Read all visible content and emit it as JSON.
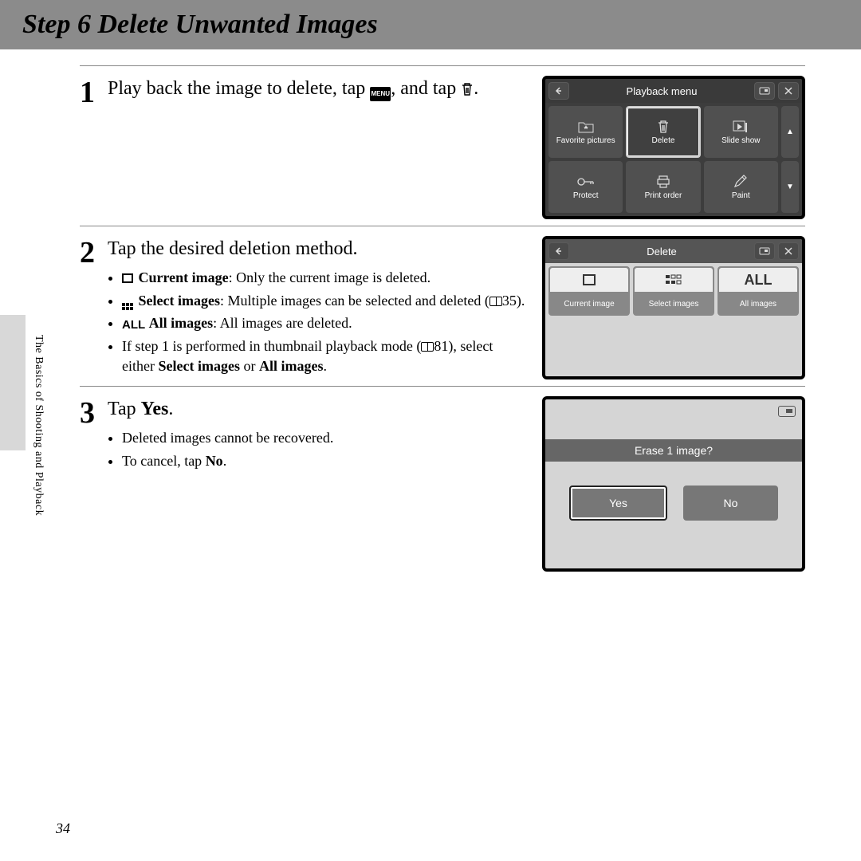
{
  "header": {
    "title": "Step 6 Delete Unwanted Images"
  },
  "sidebar_label": "The Basics of Shooting and Playback",
  "page_number": "34",
  "steps": [
    {
      "num": "1",
      "text_a": "Play back the image to delete, tap ",
      "text_b": ", and tap ",
      "text_c": ".",
      "bullets": []
    },
    {
      "num": "2",
      "text_a": "Tap the desired deletion method.",
      "bullets": [
        {
          "bold": "Current image",
          "rest": ": Only the current image is deleted."
        },
        {
          "bold": "Select images",
          "rest": ": Multiple images can be selected and deleted (",
          "ref": "35",
          "tail": ")."
        },
        {
          "bold": "All images",
          "rest": ": All images are deleted."
        },
        {
          "plain_a": "If step 1 is performed in thumbnail playback mode (",
          "ref": "81",
          "plain_b": "), select either ",
          "bold1": "Select images",
          "mid": " or ",
          "bold2": "All images",
          "end": "."
        }
      ]
    },
    {
      "num": "3",
      "text_a": "Tap ",
      "bold": "Yes",
      "text_b": ".",
      "bullets": [
        {
          "plain": "Deleted images cannot be recovered."
        },
        {
          "plain_a": "To cancel, tap ",
          "bold": "No",
          "end": "."
        }
      ]
    }
  ],
  "screen1": {
    "title": "Playback menu",
    "cells": [
      {
        "label": "Favorite pictures"
      },
      {
        "label": "Delete",
        "selected": true
      },
      {
        "label": "Slide show"
      },
      {
        "label": "Protect"
      },
      {
        "label": "Print order"
      },
      {
        "label": "Paint"
      }
    ]
  },
  "screen2": {
    "title": "Delete",
    "cells": [
      {
        "label": "Current image"
      },
      {
        "label": "Select images"
      },
      {
        "label": "All images",
        "all": true
      }
    ]
  },
  "screen3": {
    "prompt": "Erase 1 image?",
    "yes": "Yes",
    "no": "No"
  }
}
